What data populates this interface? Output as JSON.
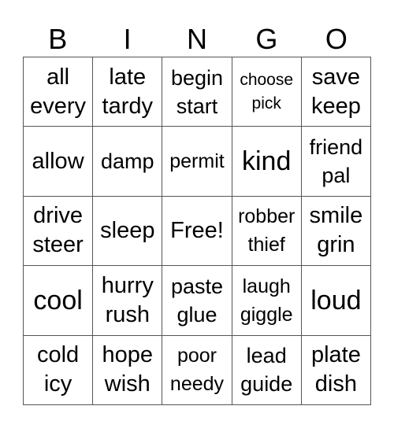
{
  "header": {
    "letters": [
      "B",
      "I",
      "N",
      "G",
      "O"
    ]
  },
  "rows": [
    [
      {
        "lines": [
          "all",
          "every"
        ]
      },
      {
        "lines": [
          "late",
          "tardy"
        ]
      },
      {
        "lines": [
          "begin",
          "start"
        ]
      },
      {
        "lines": [
          "choose",
          "pick"
        ]
      },
      {
        "lines": [
          "save",
          "keep"
        ]
      }
    ],
    [
      {
        "lines": [
          "allow"
        ]
      },
      {
        "lines": [
          "damp"
        ]
      },
      {
        "lines": [
          "permit"
        ]
      },
      {
        "lines": [
          "kind"
        ]
      },
      {
        "lines": [
          "friend",
          "pal"
        ]
      }
    ],
    [
      {
        "lines": [
          "drive",
          "steer"
        ]
      },
      {
        "lines": [
          "sleep"
        ]
      },
      {
        "lines": [
          "Free!"
        ]
      },
      {
        "lines": [
          "robber",
          "thief"
        ]
      },
      {
        "lines": [
          "smile",
          "grin"
        ]
      }
    ],
    [
      {
        "lines": [
          "cool"
        ]
      },
      {
        "lines": [
          "hurry",
          "rush"
        ]
      },
      {
        "lines": [
          "paste",
          "glue"
        ]
      },
      {
        "lines": [
          "laugh",
          "giggle"
        ]
      },
      {
        "lines": [
          "loud"
        ]
      }
    ],
    [
      {
        "lines": [
          "cold",
          "icy"
        ]
      },
      {
        "lines": [
          "hope",
          "wish"
        ]
      },
      {
        "lines": [
          "poor",
          "needy"
        ]
      },
      {
        "lines": [
          "lead",
          "guide"
        ]
      },
      {
        "lines": [
          "plate",
          "dish"
        ]
      }
    ]
  ]
}
